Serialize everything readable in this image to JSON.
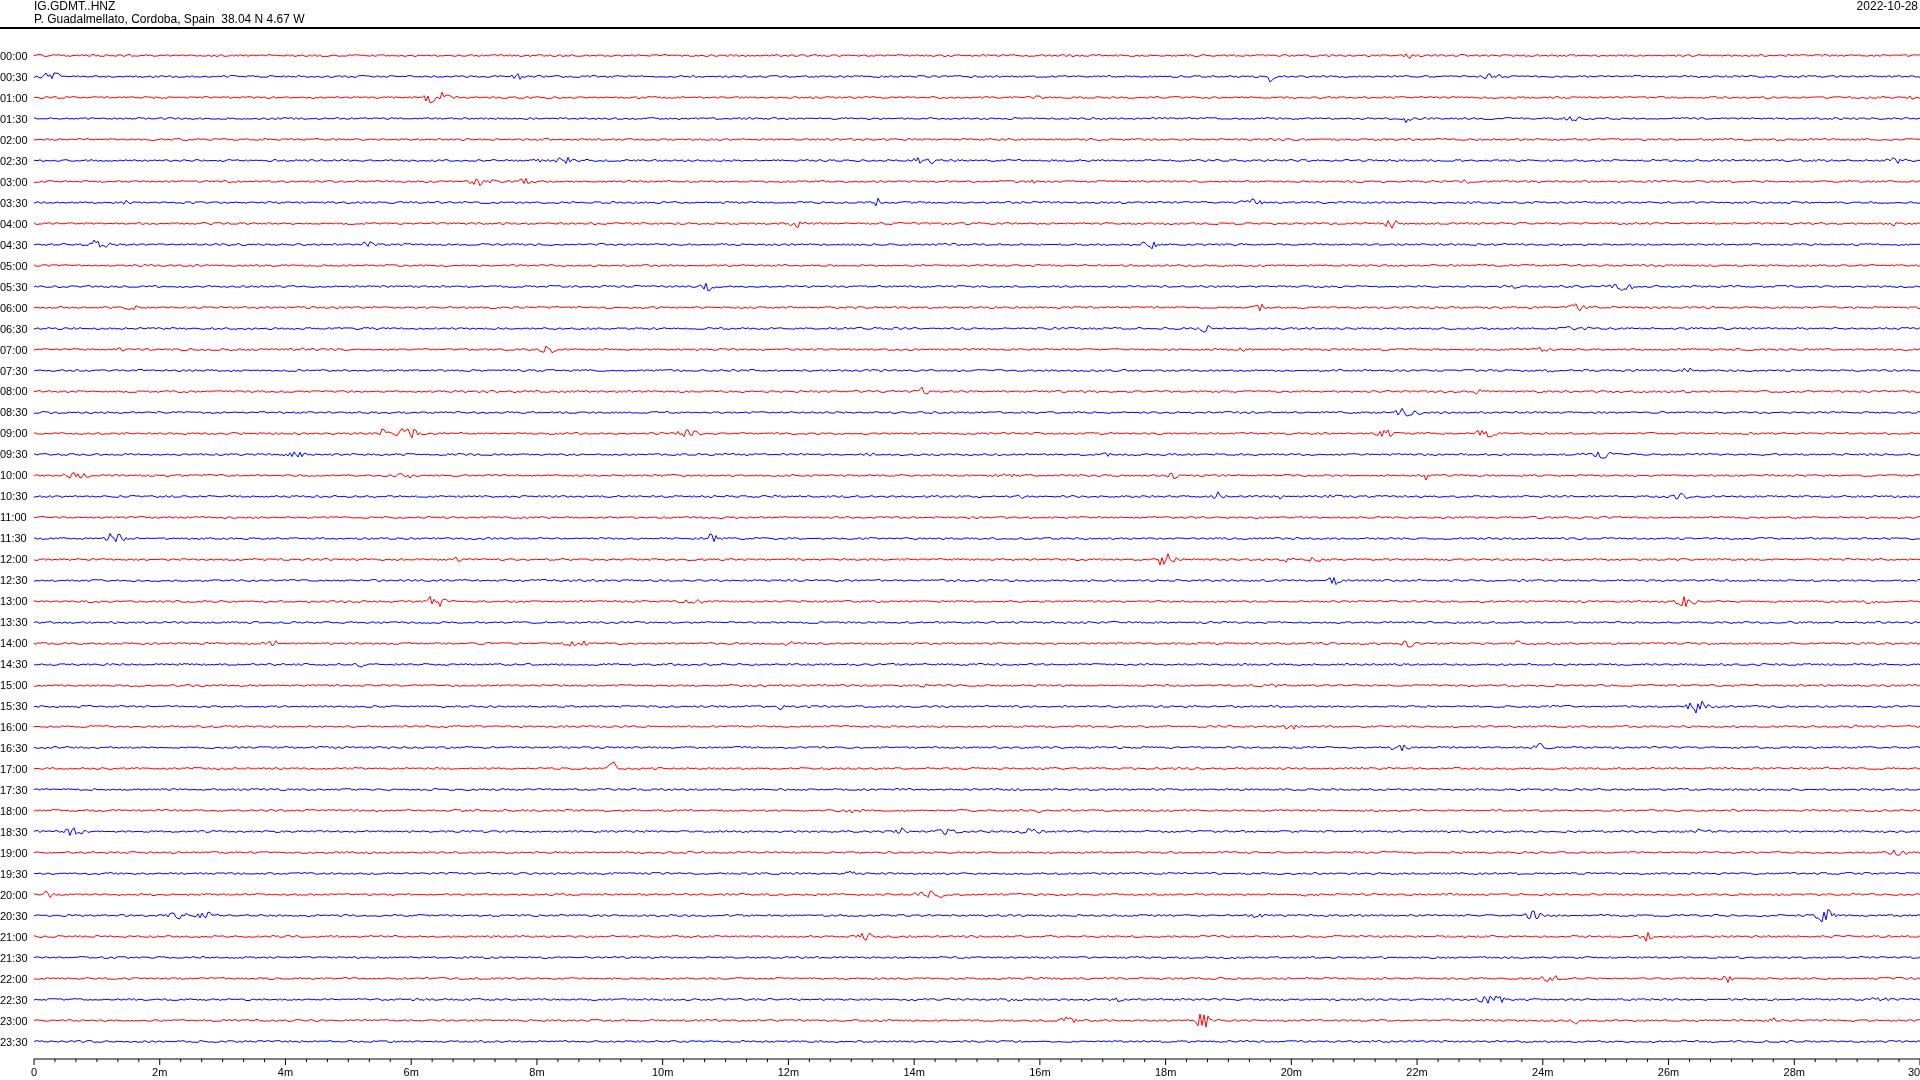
{
  "header": {
    "station": "IG.GDMT..HNZ",
    "location": "P. Guadalmellato, Cordoba, Spain  38.04 N 4.67 W",
    "date": "2022-10-28"
  },
  "rows": [
    {
      "label": "00:00",
      "color": "#ff0000"
    },
    {
      "label": "00:30",
      "color": "#0000ff"
    },
    {
      "label": "01:00",
      "color": "#ff0000"
    },
    {
      "label": "01:30",
      "color": "#0000ff"
    },
    {
      "label": "02:00",
      "color": "#ff0000"
    },
    {
      "label": "02:30",
      "color": "#0000ff"
    },
    {
      "label": "03:00",
      "color": "#ff0000"
    },
    {
      "label": "03:30",
      "color": "#0000ff"
    },
    {
      "label": "04:00",
      "color": "#ff0000"
    },
    {
      "label": "04:30",
      "color": "#0000ff"
    },
    {
      "label": "05:00",
      "color": "#ff0000"
    },
    {
      "label": "05:30",
      "color": "#0000ff"
    },
    {
      "label": "06:00",
      "color": "#ff0000"
    },
    {
      "label": "06:30",
      "color": "#0000ff"
    },
    {
      "label": "07:00",
      "color": "#ff0000"
    },
    {
      "label": "07:30",
      "color": "#0000ff"
    },
    {
      "label": "08:00",
      "color": "#ff0000"
    },
    {
      "label": "08:30",
      "color": "#0000ff"
    },
    {
      "label": "09:00",
      "color": "#ff0000"
    },
    {
      "label": "09:30",
      "color": "#0000ff"
    },
    {
      "label": "10:00",
      "color": "#ff0000"
    },
    {
      "label": "10:30",
      "color": "#0000ff"
    },
    {
      "label": "11:00",
      "color": "#ff0000"
    },
    {
      "label": "11:30",
      "color": "#0000ff"
    },
    {
      "label": "12:00",
      "color": "#ff0000"
    },
    {
      "label": "12:30",
      "color": "#0000ff"
    },
    {
      "label": "13:00",
      "color": "#ff0000"
    },
    {
      "label": "13:30",
      "color": "#0000ff"
    },
    {
      "label": "14:00",
      "color": "#ff0000"
    },
    {
      "label": "14:30",
      "color": "#0000ff"
    },
    {
      "label": "15:00",
      "color": "#ff0000"
    },
    {
      "label": "15:30",
      "color": "#0000ff"
    },
    {
      "label": "16:00",
      "color": "#ff0000"
    },
    {
      "label": "16:30",
      "color": "#0000ff"
    },
    {
      "label": "17:00",
      "color": "#ff0000"
    },
    {
      "label": "17:30",
      "color": "#0000ff"
    },
    {
      "label": "18:00",
      "color": "#ff0000"
    },
    {
      "label": "18:30",
      "color": "#0000ff"
    },
    {
      "label": "19:00",
      "color": "#ff0000"
    },
    {
      "label": "19:30",
      "color": "#0000ff"
    },
    {
      "label": "20:00",
      "color": "#ff0000"
    },
    {
      "label": "20:30",
      "color": "#0000ff"
    },
    {
      "label": "21:00",
      "color": "#ff0000"
    },
    {
      "label": "21:30",
      "color": "#0000ff"
    },
    {
      "label": "22:00",
      "color": "#ff0000"
    },
    {
      "label": "22:30",
      "color": "#0000ff"
    },
    {
      "label": "23:00",
      "color": "#ff0000"
    },
    {
      "label": "23:30",
      "color": "#0000ff"
    }
  ],
  "axis": {
    "labels": [
      "0",
      "2m",
      "4m",
      "6m",
      "8m",
      "10m",
      "12m",
      "14m",
      "16m",
      "18m",
      "20m",
      "22m",
      "24m",
      "26m",
      "28m",
      "30"
    ]
  }
}
